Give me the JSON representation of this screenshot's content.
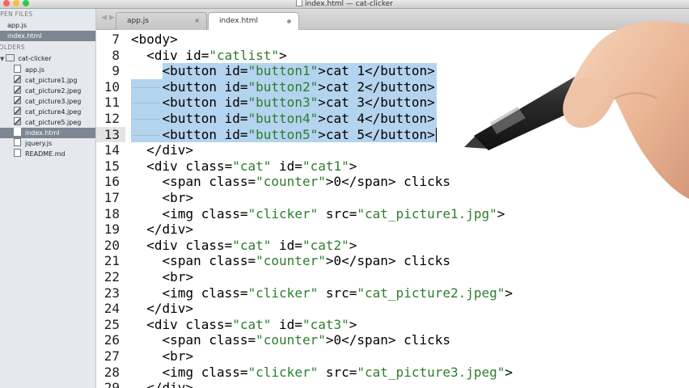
{
  "window": {
    "title": "index.html — cat-clicker"
  },
  "colors": {
    "close": "#fc605c",
    "minimize": "#fdbc40",
    "zoom": "#34c84a",
    "selection": "#b4d3ee",
    "string": "#2d7d2d"
  },
  "sidebar": {
    "open_files_header": "OPEN FILES",
    "open_files": [
      {
        "name": "app.js"
      },
      {
        "name": "index.html"
      }
    ],
    "folders_header": "FOLDERS",
    "folder": {
      "name": "cat-clicker"
    },
    "files": [
      {
        "name": "app.js",
        "icon": "file-icon"
      },
      {
        "name": "cat_picture1.jpg",
        "icon": "image-file-icon"
      },
      {
        "name": "cat_picture2.jpeg",
        "icon": "image-file-icon"
      },
      {
        "name": "cat_picture3.jpeg",
        "icon": "image-file-icon"
      },
      {
        "name": "cat_picture4.jpeg",
        "icon": "image-file-icon"
      },
      {
        "name": "cat_picture5.jpeg",
        "icon": "image-file-icon"
      },
      {
        "name": "index.html",
        "icon": "file-icon"
      },
      {
        "name": "jquery.js",
        "icon": "file-icon"
      },
      {
        "name": "README.md",
        "icon": "file-icon"
      }
    ]
  },
  "tabs": [
    {
      "label": "app.js",
      "close": "×"
    },
    {
      "label": "index.html"
    }
  ],
  "nav": {
    "back": "◀",
    "forward": "▶"
  },
  "editor": {
    "lines": [
      {
        "n": "7",
        "indent": 0,
        "parts": [
          [
            "<body>",
            0
          ]
        ]
      },
      {
        "n": "8",
        "indent": 1,
        "parts": [
          [
            "<div id=",
            0
          ],
          [
            "\"catlist\"",
            1
          ],
          [
            ">",
            0
          ]
        ]
      },
      {
        "n": "9",
        "indent": 2,
        "parts": [
          [
            "<button id=",
            0
          ],
          [
            "\"button1\"",
            1
          ],
          [
            ">cat 1</button>",
            0
          ]
        ]
      },
      {
        "n": "10",
        "indent": 2,
        "parts": [
          [
            "<button id=",
            0
          ],
          [
            "\"button2\"",
            1
          ],
          [
            ">cat 2</button>",
            0
          ]
        ]
      },
      {
        "n": "11",
        "indent": 2,
        "parts": [
          [
            "<button id=",
            0
          ],
          [
            "\"button3\"",
            1
          ],
          [
            ">cat 3</button>",
            0
          ]
        ]
      },
      {
        "n": "12",
        "indent": 2,
        "parts": [
          [
            "<button id=",
            0
          ],
          [
            "\"button4\"",
            1
          ],
          [
            ">cat 4</button>",
            0
          ]
        ]
      },
      {
        "n": "13",
        "indent": 2,
        "parts": [
          [
            "<button id=",
            0
          ],
          [
            "\"button5\"",
            1
          ],
          [
            ">cat 5</button>",
            0
          ]
        ]
      },
      {
        "n": "14",
        "indent": 1,
        "parts": [
          [
            "</div>",
            0
          ]
        ]
      },
      {
        "n": "15",
        "indent": 1,
        "parts": [
          [
            "<div class=",
            0
          ],
          [
            "\"cat\"",
            1
          ],
          [
            " id=",
            0
          ],
          [
            "\"cat1\"",
            1
          ],
          [
            ">",
            0
          ]
        ]
      },
      {
        "n": "16",
        "indent": 2,
        "parts": [
          [
            "<span class=",
            0
          ],
          [
            "\"counter\"",
            1
          ],
          [
            ">0</span> clicks",
            0
          ]
        ]
      },
      {
        "n": "17",
        "indent": 2,
        "parts": [
          [
            "<br>",
            0
          ]
        ]
      },
      {
        "n": "18",
        "indent": 2,
        "parts": [
          [
            "<img class=",
            0
          ],
          [
            "\"clicker\"",
            1
          ],
          [
            " src=",
            0
          ],
          [
            "\"cat_picture1.jpg\"",
            1
          ],
          [
            ">",
            0
          ]
        ]
      },
      {
        "n": "19",
        "indent": 1,
        "parts": [
          [
            "</div>",
            0
          ]
        ]
      },
      {
        "n": "20",
        "indent": 1,
        "parts": [
          [
            "<div class=",
            0
          ],
          [
            "\"cat\"",
            1
          ],
          [
            " id=",
            0
          ],
          [
            "\"cat2\"",
            1
          ],
          [
            ">",
            0
          ]
        ]
      },
      {
        "n": "21",
        "indent": 2,
        "parts": [
          [
            "<span class=",
            0
          ],
          [
            "\"counter\"",
            1
          ],
          [
            ">0</span> clicks",
            0
          ]
        ]
      },
      {
        "n": "22",
        "indent": 2,
        "parts": [
          [
            "<br>",
            0
          ]
        ]
      },
      {
        "n": "23",
        "indent": 2,
        "parts": [
          [
            "<img class=",
            0
          ],
          [
            "\"clicker\"",
            1
          ],
          [
            " src=",
            0
          ],
          [
            "\"cat_picture2.jpeg\"",
            1
          ],
          [
            ">",
            0
          ]
        ]
      },
      {
        "n": "24",
        "indent": 1,
        "parts": [
          [
            "</div>",
            0
          ]
        ]
      },
      {
        "n": "25",
        "indent": 1,
        "parts": [
          [
            "<div class=",
            0
          ],
          [
            "\"cat\"",
            1
          ],
          [
            " id=",
            0
          ],
          [
            "\"cat3\"",
            1
          ],
          [
            ">",
            0
          ]
        ]
      },
      {
        "n": "26",
        "indent": 2,
        "parts": [
          [
            "<span class=",
            0
          ],
          [
            "\"counter\"",
            1
          ],
          [
            ">0</span> clicks",
            0
          ]
        ]
      },
      {
        "n": "27",
        "indent": 2,
        "parts": [
          [
            "<br>",
            0
          ]
        ]
      },
      {
        "n": "28",
        "indent": 2,
        "parts": [
          [
            "<img class=",
            0
          ],
          [
            "\"clicker\"",
            1
          ],
          [
            " src=",
            0
          ],
          [
            "\"cat_picture3.jpeg\"",
            1
          ],
          [
            ">",
            0
          ]
        ]
      },
      {
        "n": "29",
        "indent": 1,
        "parts": [
          [
            "</div>",
            0
          ]
        ]
      }
    ],
    "selected_lines": [
      "9",
      "10",
      "11",
      "12",
      "13"
    ],
    "current_line": "13"
  }
}
